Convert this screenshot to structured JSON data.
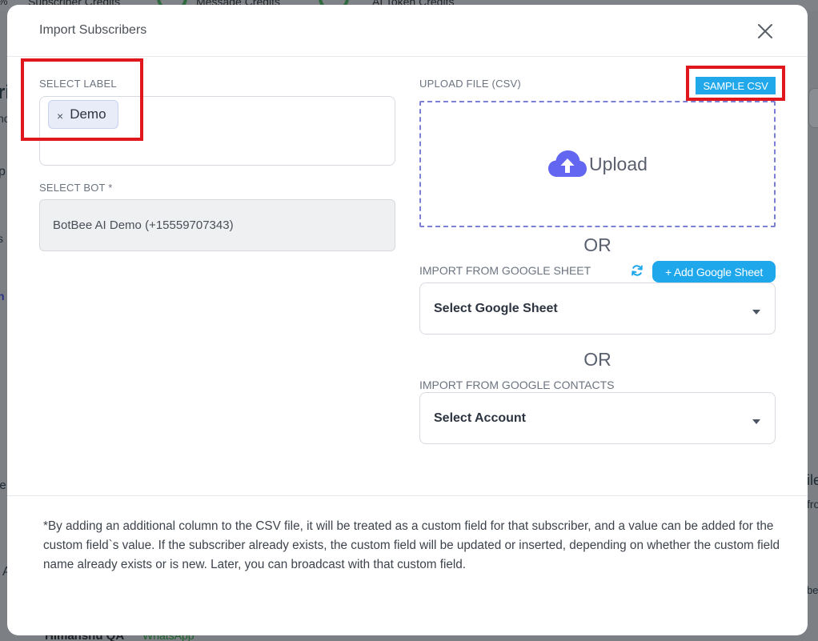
{
  "background": {
    "credits": [
      "Subscriber Credits",
      "Message Credits",
      "AI Token Credits"
    ],
    "percent_fragment": "%",
    "left_fragments": [
      "ri",
      "nc",
      "p",
      "s",
      "h",
      "le",
      "A"
    ],
    "right_fragments": [
      "ile",
      "fro",
      "be"
    ],
    "bottom_name": "Himanshu QA",
    "bottom_channel": "WhatsApp"
  },
  "modal": {
    "title": "Import Subscribers",
    "close_icon": "close-icon"
  },
  "select_label": {
    "label": "SELECT LABEL",
    "chips": [
      {
        "remove": "×",
        "text": "Demo"
      }
    ]
  },
  "select_bot": {
    "label": "SELECT BOT *",
    "value": "BotBee AI Demo (+15559707343)"
  },
  "upload": {
    "label": "UPLOAD FILE (CSV)",
    "sample_button": "SAMPLE CSV",
    "upload_text": "Upload",
    "icon": "cloud-upload-icon",
    "icon_color": "#6366f1"
  },
  "google_sheet": {
    "or_text": "OR",
    "label": "IMPORT FROM GOOGLE SHEET",
    "add_button": "+ Add Google Sheet",
    "select_placeholder": "Select Google Sheet"
  },
  "google_contacts": {
    "or_text": "OR",
    "label": "IMPORT FROM GOOGLE CONTACTS",
    "select_placeholder": "Select Account"
  },
  "footer_note": "*By adding an additional column to the CSV file, it will be treated as a custom field for that subscriber, and a value can be added for the custom field`s value. If the subscriber already exists, the custom field will be updated or inserted, depending on whether the custom field name already exists or is new. Later, you can broadcast with that custom field.",
  "colors": {
    "accent": "#1ea7ea",
    "upload_border": "#7b7fd6",
    "highlight": "#e0171c"
  }
}
